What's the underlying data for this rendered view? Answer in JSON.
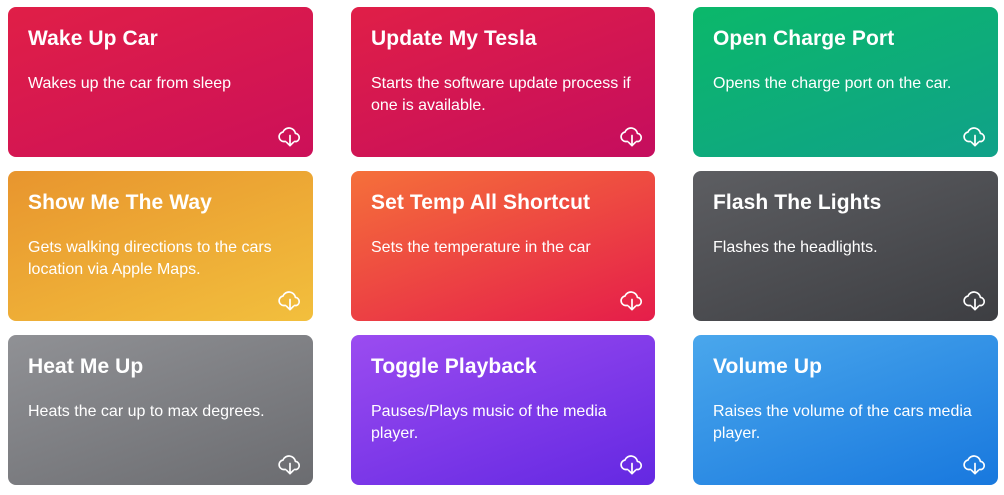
{
  "shortcuts": [
    {
      "title": "Wake Up Car",
      "description": "Wakes up the car from sleep",
      "gradient": [
        "#e01f47",
        "#cc1059"
      ],
      "name": "wake-up-car"
    },
    {
      "title": "Update My Tesla",
      "description": "Starts the software update process if one is available.",
      "gradient": [
        "#e01f47",
        "#c50d5e"
      ],
      "name": "update-my-tesla"
    },
    {
      "title": "Open Charge Port",
      "description": "Opens the charge port on the car.",
      "gradient": [
        "#0bb86a",
        "#10a189"
      ],
      "name": "open-charge-port"
    },
    {
      "title": "Show Me The Way",
      "description": "Gets walking directions to the cars location via Apple Maps.",
      "gradient": [
        "#e8952e",
        "#f2bf3d"
      ],
      "name": "show-me-the-way"
    },
    {
      "title": "Set Temp All Shortcut",
      "description": "Sets the temperature in the car",
      "gradient": [
        "#f5703a",
        "#e51d4a"
      ],
      "name": "set-temp-all-shortcut"
    },
    {
      "title": "Flash The Lights",
      "description": "Flashes the headlights.",
      "gradient": [
        "#5d5e62",
        "#3d3e42"
      ],
      "name": "flash-the-lights"
    },
    {
      "title": "Heat Me Up",
      "description": "Heats the car up to max degrees.",
      "gradient": [
        "#909195",
        "#6b6c70"
      ],
      "name": "heat-me-up"
    },
    {
      "title": "Toggle Playback",
      "description": "Pauses/Plays music of the media player.",
      "gradient": [
        "#9b4cf0",
        "#6428e2"
      ],
      "name": "toggle-playback"
    },
    {
      "title": "Volume Up",
      "description": "Raises the volume of the cars media player.",
      "gradient": [
        "#4aa7ec",
        "#1878de"
      ],
      "name": "volume-up"
    }
  ],
  "download_icon": "cloud-download-icon"
}
